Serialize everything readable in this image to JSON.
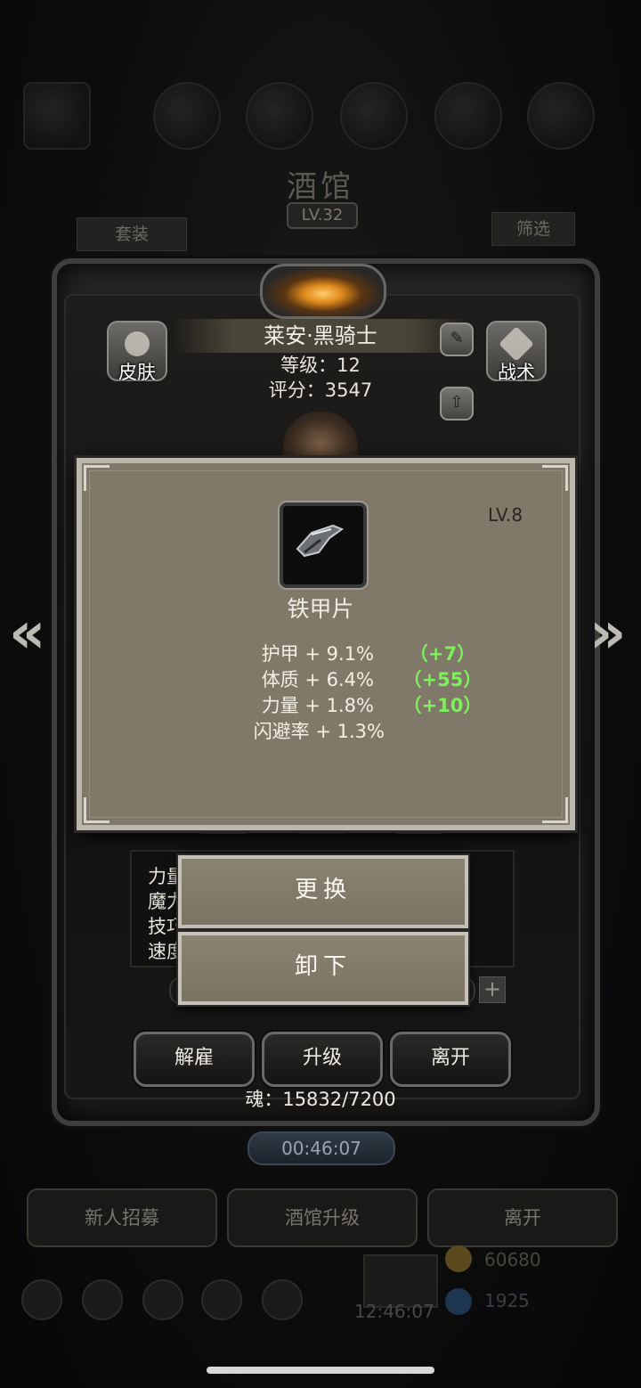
{
  "background": {
    "title": "酒馆",
    "level_badge": "LV.32",
    "btn_left": "套装",
    "btn_right": "筛选",
    "timer": "00:46:07",
    "bottom_buttons": [
      "新人招募",
      "酒馆升级",
      "离开"
    ],
    "gold": "60680",
    "gems": "1925",
    "clock": "12:46:07"
  },
  "hero": {
    "name": "莱安·黑骑士",
    "level_text": "等级：12",
    "score_text": "评分：3547",
    "skin_label": "皮肤",
    "tactics_label": "战术",
    "stat_labels": [
      "力量",
      "魔力",
      "技巧",
      "速度"
    ],
    "dismiss_label": "解雇",
    "upgrade_label": "升级",
    "leave_label": "离开",
    "soul_text": "魂：15832/7200"
  },
  "item": {
    "level": "LV.8",
    "name": "铁甲片",
    "attributes": [
      {
        "name": "护甲 + 9.1%",
        "bonus": "（+7）"
      },
      {
        "name": "体质 + 6.4%",
        "bonus": "（+55）"
      },
      {
        "name": "力量 + 1.8%",
        "bonus": "（+10）"
      },
      {
        "name": "闪避率 + 1.3%",
        "bonus": ""
      }
    ]
  },
  "actions": {
    "replace": "更换",
    "unequip": "卸下"
  },
  "colors": {
    "bonus_green": "#7df15b",
    "tooltip_bg": "#807868",
    "popup_bg": "#857e6d"
  }
}
